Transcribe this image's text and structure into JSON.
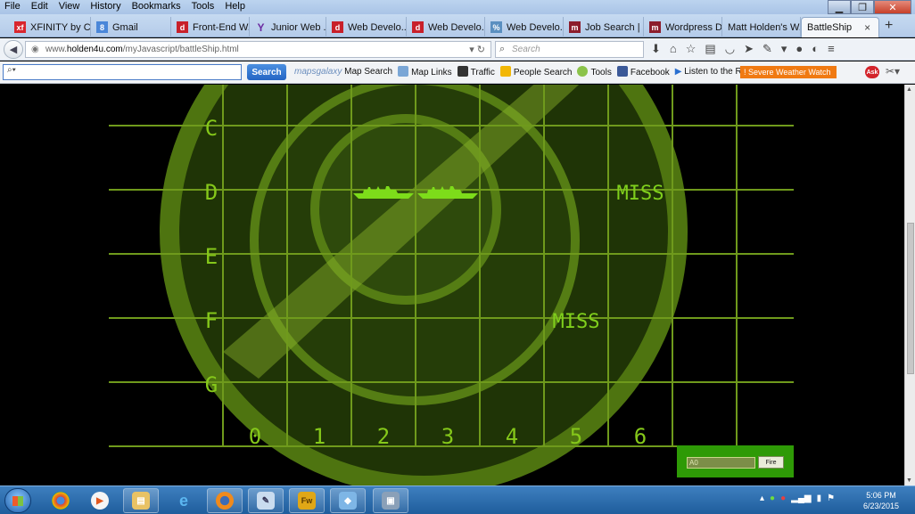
{
  "menubar": [
    "File",
    "Edit",
    "View",
    "History",
    "Bookmarks",
    "Tools",
    "Help"
  ],
  "tabs": [
    {
      "label": "XFINITY by C...",
      "icon": "xfinity-icon",
      "color": "#d9262e"
    },
    {
      "label": "Gmail",
      "icon": "gmail-icon",
      "color": "#4a87d9"
    },
    {
      "label": "Front-End W...",
      "icon": "dice-icon",
      "color": "#c8202a"
    },
    {
      "label": "Junior Web ...",
      "icon": "yahoo-icon",
      "color": "#6b2aa0"
    },
    {
      "label": "Web Develo...",
      "icon": "dice-icon",
      "color": "#c8202a"
    },
    {
      "label": "Web Develo...",
      "icon": "dice-icon",
      "color": "#c8202a"
    },
    {
      "label": "Web Develo...",
      "icon": "page-icon",
      "color": "#5a8fc0"
    },
    {
      "label": "Job Search | ...",
      "icon": "monster-icon",
      "color": "#8c1d2c"
    },
    {
      "label": "Wordpress D...",
      "icon": "monster-icon",
      "color": "#8c1d2c"
    },
    {
      "label": "Matt Holden's W...",
      "icon": "none",
      "color": ""
    },
    {
      "label": "BattleShip",
      "icon": "none",
      "color": ""
    }
  ],
  "newtab": "+",
  "tab_close": "×",
  "url": {
    "prefix": "www.",
    "host": "holden4u.com",
    "path": "/myJavascript/battleShip.html"
  },
  "search": {
    "placeholder": "Search"
  },
  "toolbar": {
    "search_button": "Search",
    "links": [
      {
        "label": "Map Search",
        "icon": "mapsgalaxy-icon",
        "brand": "mapsgalaxy"
      },
      {
        "label": "Map Links",
        "icon": "map-links-icon"
      },
      {
        "label": "Traffic",
        "icon": "traffic-light-icon"
      },
      {
        "label": "People Search",
        "icon": "people-search-icon"
      },
      {
        "label": "Tools",
        "icon": "gear-icon"
      },
      {
        "label": "Facebook",
        "icon": "facebook-icon"
      },
      {
        "label": "Listen to the Radio",
        "icon": "play-icon"
      }
    ],
    "weather": "! Severe Weather Watch",
    "ask": "Ask"
  },
  "board": {
    "row_labels": [
      "C",
      "D",
      "E",
      "F",
      "G"
    ],
    "col_labels": [
      "0",
      "1",
      "2",
      "3",
      "4",
      "5",
      "6"
    ],
    "misses": [
      {
        "row": "D",
        "col": "6",
        "text": "MISS"
      },
      {
        "row": "F",
        "col": "5",
        "text": "MISS"
      }
    ],
    "hits": [
      {
        "row": "D",
        "col": "2"
      },
      {
        "row": "D",
        "col": "3"
      }
    ],
    "colors": {
      "grid": "#6f9a1c",
      "radar": "#557d14",
      "label": "#85c81a",
      "ship": "#7ddc1a",
      "miss": "#7fcf1c"
    }
  },
  "fire": {
    "input_value": "A0",
    "button": "Fire"
  },
  "taskbar": {
    "apps": [
      "chrome-icon",
      "media-player-icon",
      "file-explorer-icon",
      "internet-explorer-icon",
      "firefox-icon",
      "notepad-icon",
      "fireworks-icon",
      "virtualbox-icon",
      "app-icon"
    ],
    "fireworks_label": "Fw",
    "time": "5:06 PM",
    "date": "6/23/2015"
  }
}
